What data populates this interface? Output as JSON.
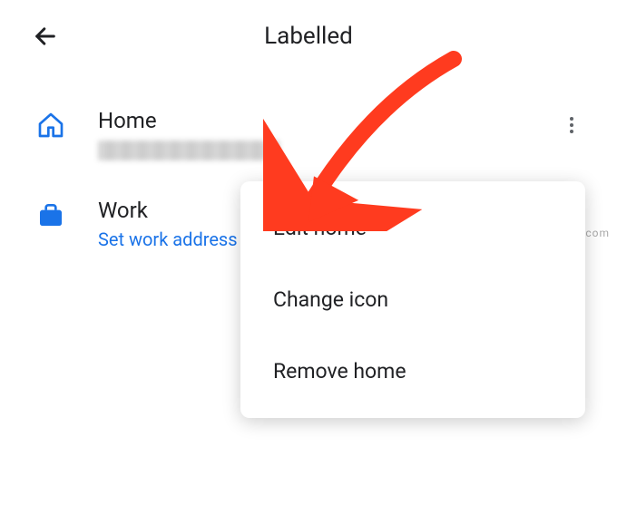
{
  "header": {
    "title": "Labelled"
  },
  "items": {
    "home": {
      "label": "Home"
    },
    "work": {
      "label": "Work",
      "action": "Set work address"
    }
  },
  "menu": {
    "edit": "Edit home",
    "change_icon": "Change icon",
    "remove": "Remove home"
  },
  "colors": {
    "accent": "#1a73e8",
    "text": "#202124",
    "arrow": "#ff3b1f"
  },
  "watermark": "wsxdn.com"
}
